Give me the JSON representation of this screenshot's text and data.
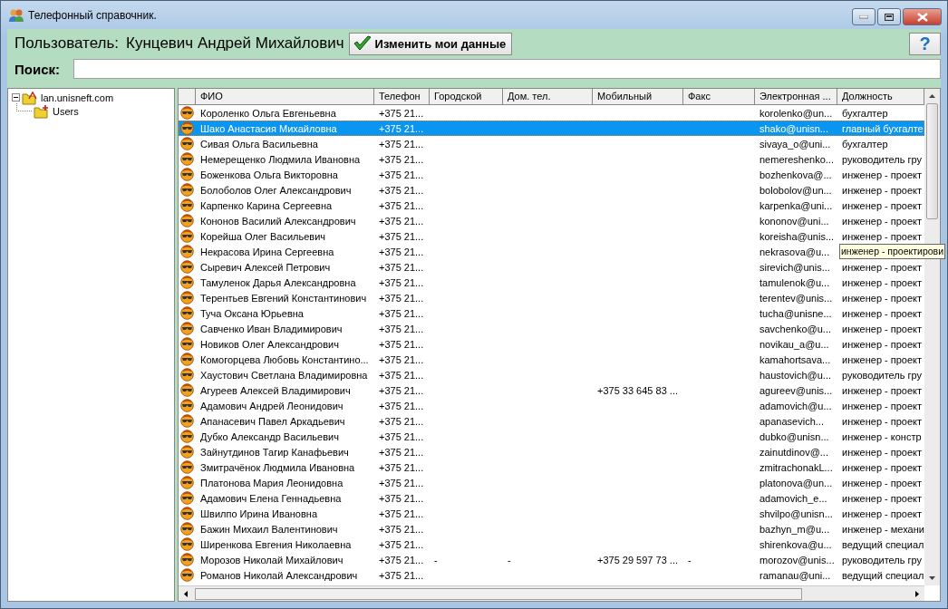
{
  "window": {
    "title": "Телефонный справочник."
  },
  "user_bar": {
    "label": "Пользователь:",
    "user_name": "Кунцевич Андрей Михайлович",
    "edit_button": "Изменить мои данные",
    "help_button": "?"
  },
  "search": {
    "label": "Поиск:"
  },
  "tree": [
    {
      "label": "lan.unisneft.com",
      "expanded": true,
      "children": [
        {
          "label": "Users"
        }
      ]
    }
  ],
  "table": {
    "columns": [
      "ФИО",
      "Телефон",
      "Городской",
      "Дом. тел.",
      "Мобильный",
      "Факс",
      "Электронная ...",
      "Должность"
    ],
    "rows": [
      {
        "name": "Короленко Ольга Евгеньевна",
        "phone": "+375 21...",
        "email": "korolenko@un...",
        "position": "бухгалтер",
        "selected": false
      },
      {
        "name": "Шако Анастасия Михайловна",
        "phone": "+375 21...",
        "email": "shako@unisn...",
        "position": "главный бухгалте",
        "selected": true
      },
      {
        "name": "Сивая Ольга Васильевна",
        "phone": "+375 21...",
        "email": "sivaya_o@uni...",
        "position": "бухгалтер",
        "selected": false
      },
      {
        "name": "Немерещенко Людмила Ивановна",
        "phone": "+375 21...",
        "email": "nemereshenko...",
        "position": "руководитель гру",
        "selected": false
      },
      {
        "name": "Боженкова Ольга Викторовна",
        "phone": "+375 21...",
        "email": "bozhenkova@...",
        "position": "инженер - проект",
        "selected": false
      },
      {
        "name": "Болоболов Олег Александрович",
        "phone": "+375 21...",
        "email": "bolobolov@un...",
        "position": "инженер - проект",
        "selected": false
      },
      {
        "name": "Карпенко Карина Сергеевна",
        "phone": "+375 21...",
        "email": "karpenka@uni...",
        "position": "инженер - проект",
        "selected": false
      },
      {
        "name": "Кононов Василий Александрович",
        "phone": "+375 21...",
        "email": "kononov@uni...",
        "position": "инженер - проект",
        "selected": false
      },
      {
        "name": "Корейша Олег Васильевич",
        "phone": "+375 21...",
        "email": "koreisha@unis...",
        "position": "инженер - проект",
        "selected": false
      },
      {
        "name": "Некрасова Ирина Сергеевна",
        "phone": "+375 21...",
        "email": "nekrasova@u...",
        "tooltip": "инженер - проектирови",
        "selected": false
      },
      {
        "name": "Сыревич Алексей Петрович",
        "phone": "+375 21...",
        "email": "sirevich@unis...",
        "position": "инженер - проект",
        "selected": false
      },
      {
        "name": "Тамуленок Дарья Александровна",
        "phone": "+375 21...",
        "email": "tamulenok@u...",
        "position": "инженер - проект",
        "selected": false
      },
      {
        "name": "Терентьев Евгений Константинович",
        "phone": "+375 21...",
        "email": "terentev@unis...",
        "position": "инженер - проект",
        "selected": false
      },
      {
        "name": "Туча Оксана Юрьевна",
        "phone": "+375 21...",
        "email": "tucha@unisne...",
        "position": "инженер - проект",
        "selected": false
      },
      {
        "name": "Савченко Иван Владимирович",
        "phone": "+375 21...",
        "email": "savchenko@u...",
        "position": "инженер - проект",
        "selected": false
      },
      {
        "name": "Новиков Олег Александрович",
        "phone": "+375 21...",
        "email": "novikau_a@u...",
        "position": "инженер - проект",
        "selected": false
      },
      {
        "name": "Комогорцева Любовь Константино...",
        "phone": "+375 21...",
        "email": "kamahortsava...",
        "position": "инженер - проект",
        "selected": false
      },
      {
        "name": "Хаустович Светлана Владимировна",
        "phone": "+375 21...",
        "email": "haustovich@u...",
        "position": "руководитель гру",
        "selected": false
      },
      {
        "name": "Агуреев Алексей Владимирович",
        "phone": "+375 21...",
        "mobile": "+375 33 645 83 ...",
        "email": "agureev@unis...",
        "position": "инженер - проект",
        "selected": false
      },
      {
        "name": "Адамович Андрей Леонидович",
        "phone": "+375 21...",
        "email": "adamovich@u...",
        "position": "инженер - проект",
        "selected": false
      },
      {
        "name": "Апанасевич Павел Аркадьевич",
        "phone": "+375 21...",
        "email": "apanasevich...",
        "position": "инженер - проект",
        "selected": false
      },
      {
        "name": "Дубко Александр Васильевич",
        "phone": "+375 21...",
        "email": "dubko@unisn...",
        "position": "инженер - констр",
        "selected": false
      },
      {
        "name": "Зайнутдинов Тагир Канафьевич",
        "phone": "+375 21...",
        "email": "zainutdinov@...",
        "position": "инженер - проект",
        "selected": false
      },
      {
        "name": "Змитрачёнок Людмила Ивановна",
        "phone": "+375 21...",
        "email": "zmitrachonakL...",
        "position": "инженер - проект",
        "selected": false
      },
      {
        "name": "Платонова Мария Леонидовна",
        "phone": "+375 21...",
        "email": "platonova@un...",
        "position": "инженер - проект",
        "selected": false
      },
      {
        "name": "Адамович Елена Геннадьевна",
        "phone": "+375 21...",
        "email": "adamovich_e...",
        "position": "инженер - проект",
        "selected": false
      },
      {
        "name": "Швилпо Ирина Ивановна",
        "phone": "+375 21...",
        "email": "shvilpo@unisn...",
        "position": "инженер - проект",
        "selected": false
      },
      {
        "name": "Бажин Михаил Валентинович",
        "phone": "+375 21...",
        "email": "bazhyn_m@u...",
        "position": "инженер - механи",
        "selected": false
      },
      {
        "name": "Ширенкова Евгения Николаевна",
        "phone": "+375 21...",
        "email": "shirenkova@u...",
        "position": "ведущий специал",
        "selected": false
      },
      {
        "name": "Морозов Николай Михайлович",
        "phone": "+375 21...",
        "city_phone": "-",
        "home_phone": "-",
        "mobile": "+375 29 597 73 ...",
        "fax": "-",
        "email": "morozov@unis...",
        "position": "руководитель гру",
        "selected": false
      },
      {
        "name": "Романов Николай Александрович",
        "phone": "+375 21...",
        "email": "ramanau@uni...",
        "position": "ведущий специал",
        "selected": false
      }
    ]
  }
}
